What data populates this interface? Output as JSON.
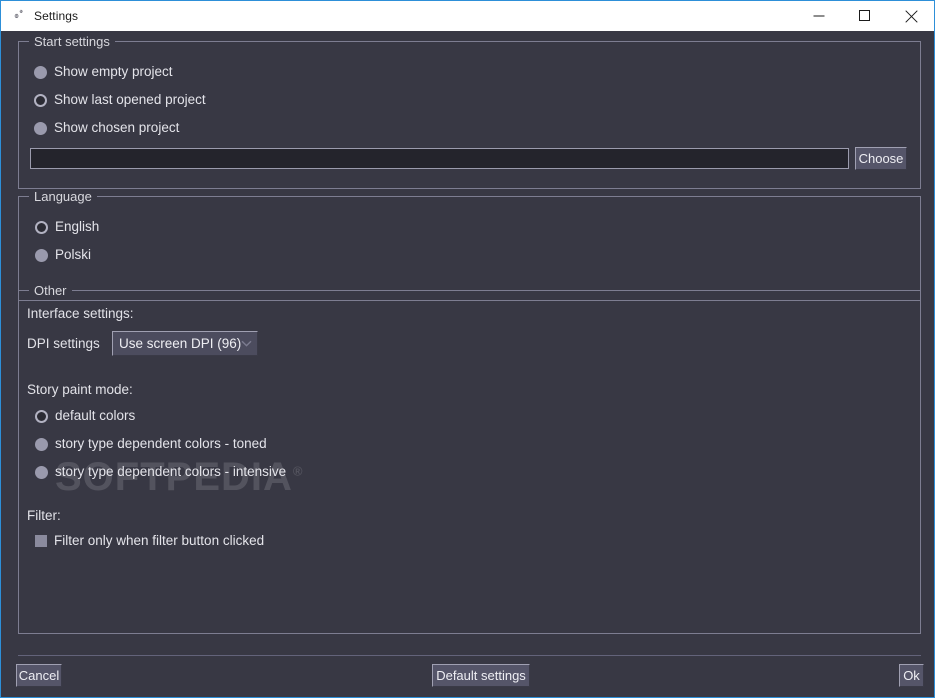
{
  "window": {
    "title": "Settings",
    "icon": "gears-icon",
    "controls": {
      "minimize": "minimize-icon",
      "maximize": "maximize-icon",
      "close": "close-icon"
    },
    "accent_color": "#2d8fd8",
    "background_color": "#383844"
  },
  "start_settings": {
    "title": "Start settings",
    "options": [
      {
        "label": "Show empty project",
        "selected": false
      },
      {
        "label": "Show last opened project",
        "selected": true
      },
      {
        "label": "Show chosen project",
        "selected": false
      }
    ],
    "project_path": {
      "value": "",
      "placeholder": ""
    },
    "choose_button": "Choose"
  },
  "language": {
    "title": "Language",
    "options": [
      {
        "label": "English",
        "selected": true
      },
      {
        "label": "Polski",
        "selected": false
      }
    ]
  },
  "other": {
    "title": "Other",
    "interface_settings_label": "Interface settings:",
    "dpi": {
      "label": "DPI settings",
      "selected": "Use screen DPI (96)"
    },
    "story_paint_mode": {
      "label": "Story paint mode:",
      "options": [
        {
          "label": "default colors",
          "selected": true
        },
        {
          "label": "story type dependent colors - toned",
          "selected": false
        },
        {
          "label": "story type dependent colors - intensive",
          "selected": false
        }
      ]
    },
    "filter": {
      "label": "Filter:",
      "checkbox_label": "Filter only when filter button clicked",
      "checked": false
    }
  },
  "footer": {
    "cancel": "Cancel",
    "default_settings": "Default settings",
    "ok": "Ok"
  },
  "watermark": {
    "text": "SOFTPEDIA",
    "mark": "®"
  }
}
